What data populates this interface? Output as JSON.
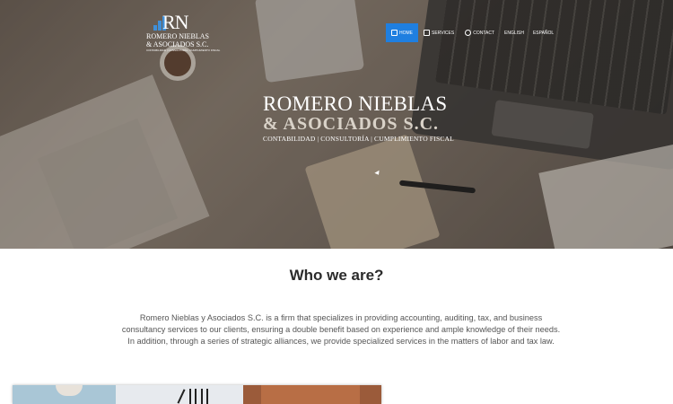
{
  "logo": {
    "mark": "RN",
    "line1": "ROMERO NIEBLAS",
    "line2": "& ASOCIADOS S.C.",
    "line3": "CONTABILIDAD | CONSULTORÍA | CUMPLIMIENTO FISCAL"
  },
  "nav": {
    "home": "HOME",
    "services": "SERVICES",
    "contact": "CONTACT",
    "english": "ENGLISH",
    "espanol": "ESPAÑOL"
  },
  "hero": {
    "title_line1": "ROMERO NIEBLAS",
    "title_line2": "& ASOCIADOS S.C.",
    "tagline": "CONTABILIDAD | CONSULTORÍA | CUMPLIMIENTO FISCAL"
  },
  "about": {
    "heading": "Who we are?",
    "body": "Romero Nieblas y Asociados S.C. is a firm that specializes in providing accounting, auditing, tax, and business consultancy services to our clients, ensuring a double benefit based on experience and ample knowledge of their needs. In addition, through a series of strategic alliances, we provide specialized services in the matters of labor and tax law."
  },
  "colors": {
    "nav_active": "#1f7fe0",
    "logo_accent": "#3f8fd8"
  }
}
